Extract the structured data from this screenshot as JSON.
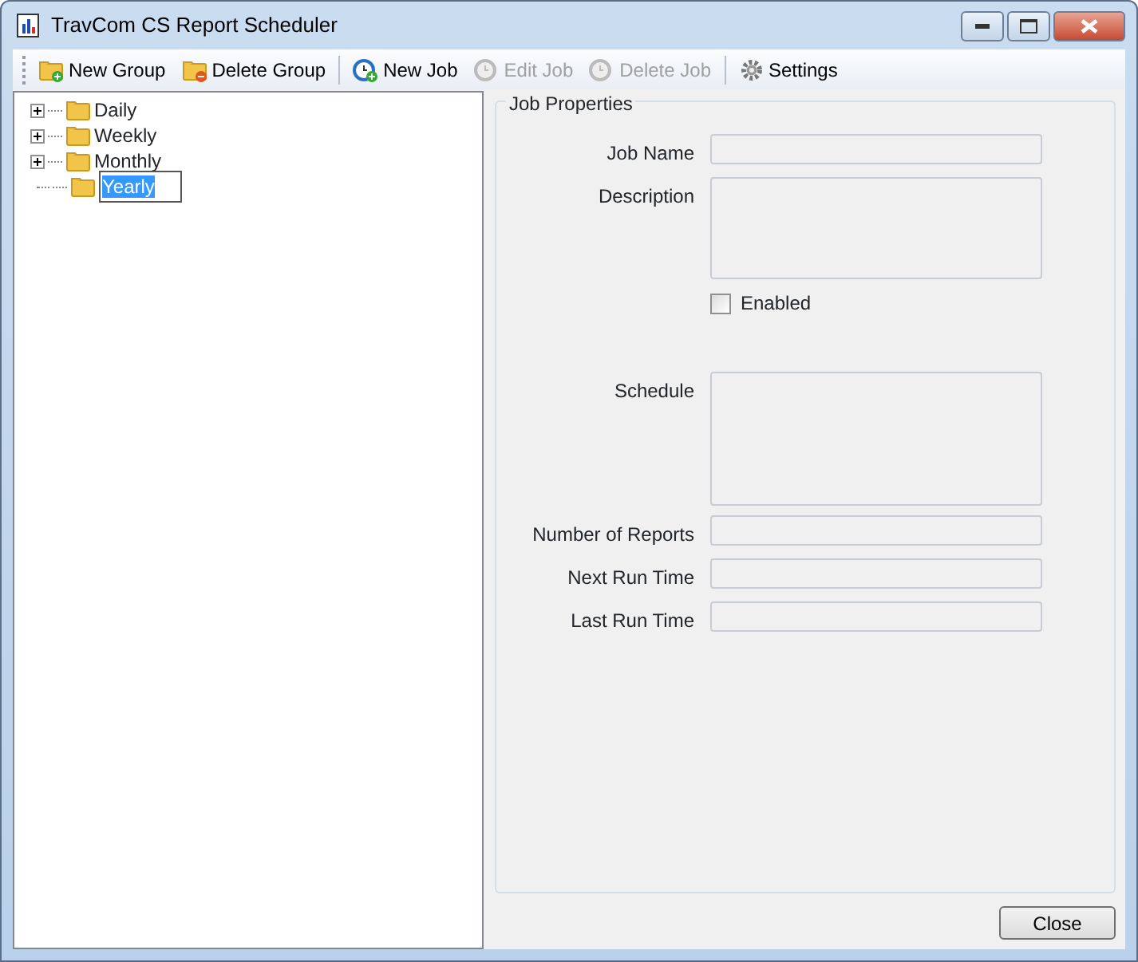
{
  "window": {
    "title": "TravCom CS Report Scheduler"
  },
  "toolbar": [
    {
      "label": "New Group",
      "kind": "folder-add",
      "disabled": false
    },
    {
      "label": "Delete Group",
      "kind": "folder-remove",
      "disabled": false
    },
    {
      "label": "New Job",
      "kind": "clock-add",
      "disabled": false,
      "separator_before": true
    },
    {
      "label": "Edit Job",
      "kind": "clock",
      "disabled": true
    },
    {
      "label": "Delete Job",
      "kind": "clock",
      "disabled": true
    },
    {
      "label": "Settings",
      "kind": "gear",
      "disabled": false,
      "separator_before": true
    }
  ],
  "tree": [
    {
      "label": "Daily",
      "expandable": true,
      "editing": false
    },
    {
      "label": "Weekly",
      "expandable": true,
      "editing": false
    },
    {
      "label": "Monthly",
      "expandable": true,
      "editing": false
    },
    {
      "label": "Yearly",
      "expandable": false,
      "editing": true
    }
  ],
  "job_properties": {
    "title": "Job Properties",
    "fields": [
      {
        "label": "Job Name",
        "kind": "text"
      },
      {
        "label": "Description",
        "kind": "textarea"
      },
      {
        "label": "Enabled",
        "kind": "checkbox",
        "checked": false
      },
      {
        "label": "Schedule",
        "kind": "bigarea"
      },
      {
        "label": "Number of Reports",
        "kind": "text"
      },
      {
        "label": "Next Run Time",
        "kind": "text"
      },
      {
        "label": "Last Run Time",
        "kind": "text"
      }
    ]
  },
  "buttons": [
    {
      "label": "Close"
    }
  ]
}
